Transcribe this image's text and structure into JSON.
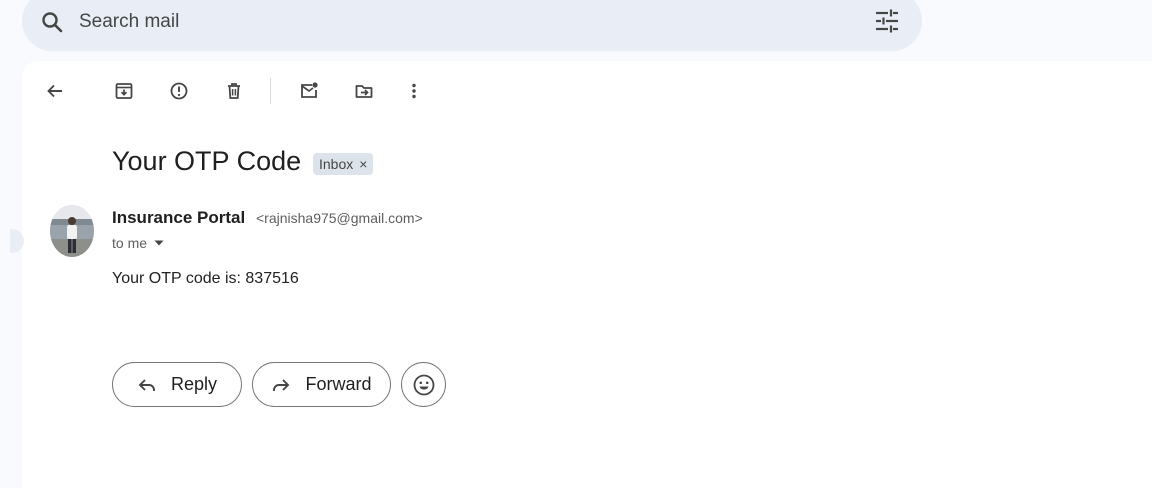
{
  "search": {
    "placeholder": "Search mail"
  },
  "icons": {
    "search": "search-icon",
    "search_options": "tune-icon",
    "back": "arrow-left-icon",
    "archive": "archive-icon",
    "spam": "report-spam-icon",
    "delete": "trash-icon",
    "mark_unread": "mark-unread-icon",
    "move_to": "move-to-folder-icon",
    "more": "more-vert-icon",
    "reply": "reply-icon",
    "forward": "forward-icon",
    "emoji": "emoji-icon"
  },
  "message": {
    "subject": "Your OTP Code",
    "label": "Inbox",
    "label_remove": "×",
    "sender_name": "Insurance Portal",
    "sender_email": "<rajnisha975@gmail.com>",
    "recipient": "to me",
    "body": "Your OTP code is: 837516"
  },
  "actions": {
    "reply": "Reply",
    "forward": "Forward"
  },
  "colors": {
    "search_bg": "#e9eef6",
    "page_bg": "#f8fafd",
    "panel_bg": "#ffffff",
    "chip_bg": "#dde3ea"
  }
}
